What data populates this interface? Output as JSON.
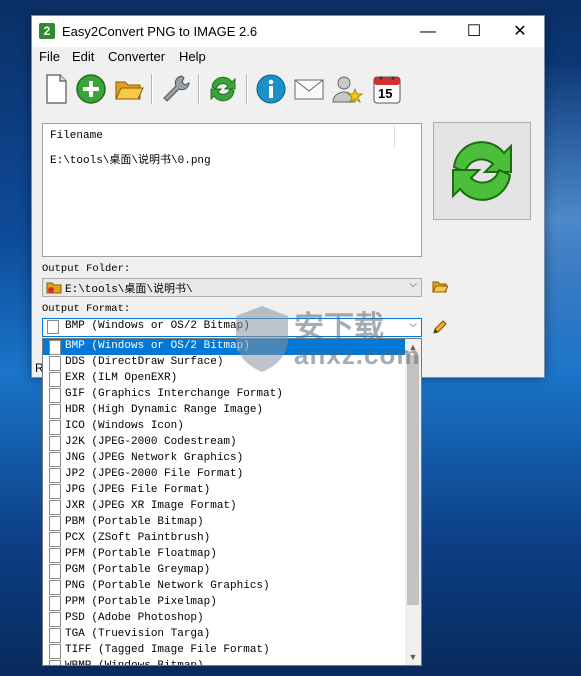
{
  "window": {
    "title": "Easy2Convert PNG to IMAGE 2.6",
    "app_icon_glyph": "2",
    "controls": {
      "minimize": "—",
      "maximize": "☐",
      "close": "✕"
    }
  },
  "menu": [
    "File",
    "Edit",
    "Converter",
    "Help"
  ],
  "toolbar": [
    {
      "icon": "new-file-icon",
      "tooltip": "New"
    },
    {
      "icon": "add-icon",
      "tooltip": "Add"
    },
    {
      "icon": "open-folder-icon",
      "tooltip": "Open"
    },
    {
      "icon": "wrench-icon",
      "tooltip": "Settings"
    },
    {
      "icon": "refresh-convert-icon",
      "tooltip": "Convert"
    },
    {
      "icon": "info-icon",
      "tooltip": "About"
    },
    {
      "icon": "envelope-icon",
      "tooltip": "Contact"
    },
    {
      "icon": "user-star-icon",
      "tooltip": "Register"
    },
    {
      "icon": "calendar-icon",
      "tooltip": "Updates",
      "day": "15"
    }
  ],
  "file_list": {
    "header": "Filename",
    "rows": [
      "E:\\tools\\桌面\\说明书\\0.png"
    ]
  },
  "output_folder": {
    "label": "Output Folder:",
    "value": "E:\\tools\\桌面\\说明书\\"
  },
  "output_format": {
    "label": "Output Format:",
    "value": "BMP (Windows or OS/2 Bitmap)",
    "options": [
      "BMP (Windows or OS/2 Bitmap)",
      "DDS (DirectDraw Surface)",
      "EXR (ILM OpenEXR)",
      "GIF (Graphics Interchange Format)",
      "HDR (High Dynamic Range Image)",
      "ICO (Windows Icon)",
      "J2K (JPEG-2000 Codestream)",
      "JNG (JPEG Network Graphics)",
      "JP2 (JPEG-2000 File Format)",
      "JPG (JPEG File Format)",
      "JXR (JPEG XR Image Format)",
      "PBM (Portable Bitmap)",
      "PCX (ZSoft Paintbrush)",
      "PFM (Portable Floatmap)",
      "PGM (Portable Greymap)",
      "PNG (Portable Network Graphics)",
      "PPM (Portable Pixelmap)",
      "PSD (Adobe Photoshop)",
      "TGA (Truevision Targa)",
      "TIFF (Tagged Image File Format)",
      "WBMP (Windows Bitmap)"
    ],
    "selected_index": 0
  },
  "status_fragment": "R",
  "watermark": {
    "cn": "安下载",
    "domain": "anxz.com"
  },
  "colors": {
    "selection": "#0078d7",
    "accent_green": "#3aa33a"
  }
}
